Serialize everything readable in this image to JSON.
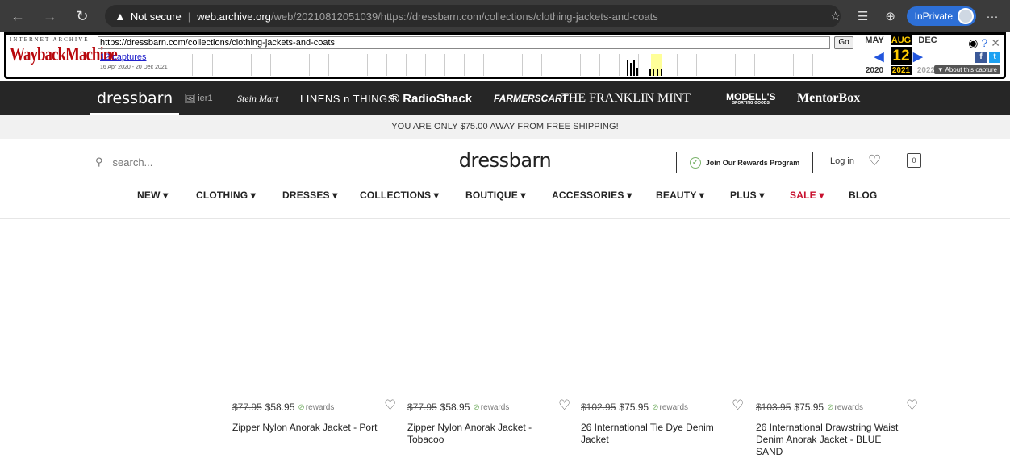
{
  "browser": {
    "not_secure": "Not secure",
    "url_host": "web.archive.org",
    "url_path": "/web/20210812051039/https://dressbarn.com/collections/clothing-jackets-and-coats",
    "inprivate": "InPrivate"
  },
  "wayback": {
    "logo_top": "INTERNET ARCHIVE",
    "logo": "WaybackMachine",
    "url": "https://dressbarn.com/collections/clothing-jackets-and-coats",
    "go": "Go",
    "captures": "12 captures",
    "range": "16 Apr 2020 - 20 Dec 2021",
    "months": [
      "MAY",
      "AUG",
      "DEC"
    ],
    "day": "12",
    "years": [
      "2020",
      "2021",
      "2022"
    ],
    "about": "▼ About this capture"
  },
  "brands": [
    "dressbarn",
    "ier1",
    "Stein Mart",
    "LINENS n THINGS",
    "® RadioShack",
    "FARMERSCART",
    "THE FRANKLIN MINT",
    "MODELL'S",
    "SPORTING GOODS",
    "MentorBox"
  ],
  "shipping_banner": "YOU ARE ONLY $75.00 AWAY FROM FREE SHIPPING!",
  "header": {
    "search_placeholder": "search...",
    "logo": "dressbarn",
    "rewards_label": "Join Our Rewards Program",
    "login": "Log in",
    "bag_count": "0"
  },
  "nav": [
    "NEW ▾",
    "CLOTHING ▾",
    "DRESSES ▾",
    "COLLECTIONS ▾",
    "BOUTIQUE ▾",
    "ACCESSORIES ▾",
    "BEAUTY ▾",
    "PLUS ▾",
    "SALE ▾",
    "BLOG"
  ],
  "products": [
    {
      "old_price": "$77.95",
      "price": "$58.95",
      "rewards": "rewards",
      "name": "Zipper Nylon Anorak Jacket - Port"
    },
    {
      "old_price": "$77.95",
      "price": "$58.95",
      "rewards": "rewards",
      "name": "Zipper Nylon Anorak Jacket - Tobacoo"
    },
    {
      "old_price": "$102.95",
      "price": "$75.95",
      "rewards": "rewards",
      "name": "26 International Tie Dye Denim Jacket"
    },
    {
      "old_price": "$103.95",
      "price": "$75.95",
      "rewards": "rewards",
      "name": "26 International Drawstring Waist Denim Anorak Jacket - BLUE SAND"
    }
  ]
}
